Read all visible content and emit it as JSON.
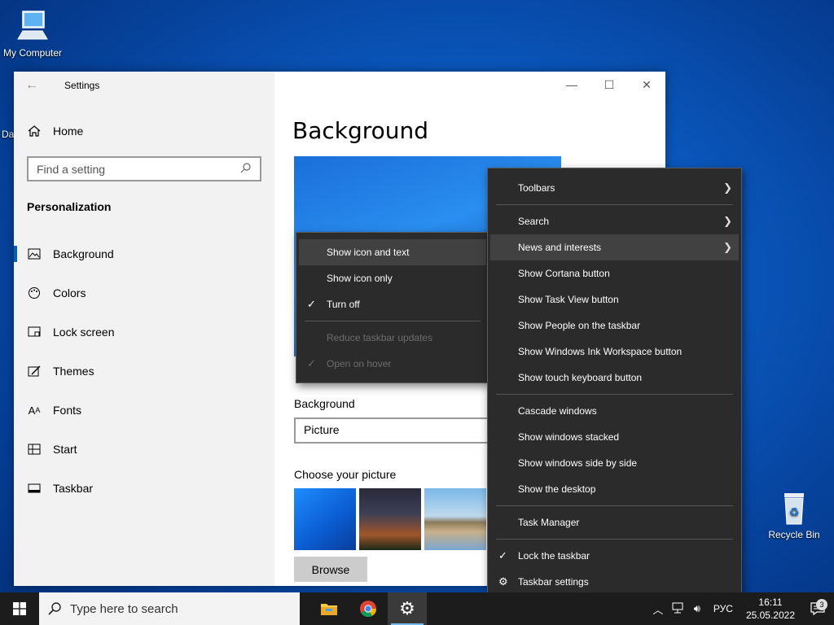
{
  "desktop": {
    "my_computer_label": "My Computer",
    "recycle_bin_label": "Recycle Bin",
    "partial_label": "Da"
  },
  "settings": {
    "title": "Settings",
    "home_label": "Home",
    "search_placeholder": "Find a setting",
    "section_heading": "Personalization",
    "nav_items": [
      {
        "label": "Background",
        "icon": "image-icon"
      },
      {
        "label": "Colors",
        "icon": "palette-icon"
      },
      {
        "label": "Lock screen",
        "icon": "lock-screen-icon"
      },
      {
        "label": "Themes",
        "icon": "themes-icon"
      },
      {
        "label": "Fonts",
        "icon": "fonts-icon"
      },
      {
        "label": "Start",
        "icon": "start-icon"
      },
      {
        "label": "Taskbar",
        "icon": "taskbar-icon"
      }
    ],
    "page_title": "Background",
    "background_label": "Background",
    "background_value": "Picture",
    "choose_label": "Choose your picture",
    "browse_label": "Browse"
  },
  "taskbar_menu": {
    "items": [
      {
        "label": "Toolbars",
        "submenu": true
      },
      {
        "label": "Search",
        "submenu": true
      },
      {
        "label": "News and interests",
        "submenu": true
      },
      {
        "label": "Show Cortana button"
      },
      {
        "label": "Show Task View button"
      },
      {
        "label": "Show People on the taskbar"
      },
      {
        "label": "Show Windows Ink Workspace button"
      },
      {
        "label": "Show touch keyboard button"
      },
      {
        "label": "Cascade windows"
      },
      {
        "label": "Show windows stacked"
      },
      {
        "label": "Show windows side by side"
      },
      {
        "label": "Show the desktop"
      },
      {
        "label": "Task Manager"
      },
      {
        "label": "Lock the taskbar",
        "checked": true
      },
      {
        "label": "Taskbar settings",
        "icon": "gear-icon"
      }
    ]
  },
  "news_submenu": {
    "items": [
      {
        "label": "Show icon and text"
      },
      {
        "label": "Show icon only"
      },
      {
        "label": "Turn off",
        "checked": true
      },
      {
        "label": "Reduce taskbar updates",
        "disabled": true
      },
      {
        "label": "Open on hover",
        "checked": true,
        "disabled": true
      }
    ]
  },
  "taskbar": {
    "search_placeholder": "Type here to search",
    "language": "РУС",
    "time": "16:11",
    "date": "25.05.2022",
    "notification_count": "3"
  },
  "colors": {
    "accent": "#0063b1",
    "menu_bg": "#2b2b2b",
    "taskbar_bg": "#1c1c1c"
  }
}
